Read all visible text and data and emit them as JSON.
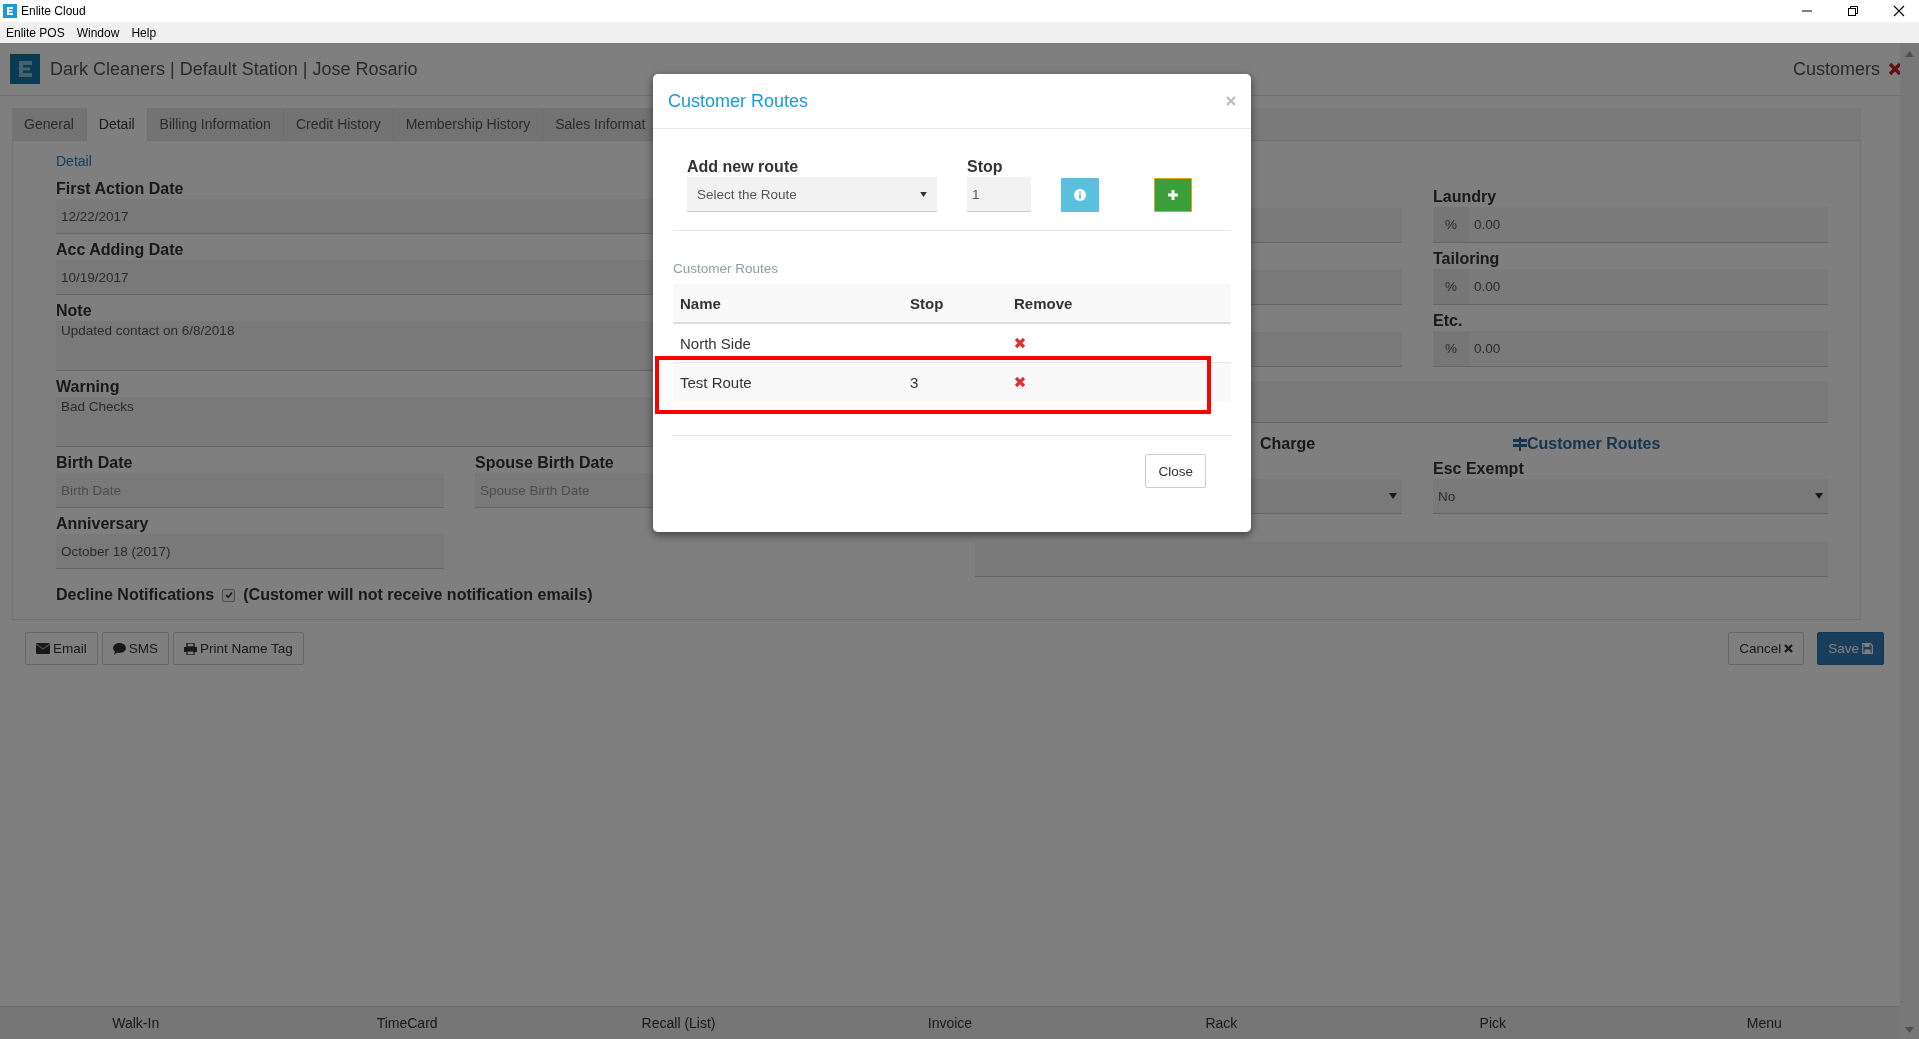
{
  "window": {
    "title": "Enlite Cloud"
  },
  "menu_bar": [
    "Enlite POS",
    "Window",
    "Help"
  ],
  "header": {
    "title": "Dark Cleaners | Default Station | Jose Rosario",
    "page": "Customers"
  },
  "tabs": [
    {
      "label": "General",
      "selected": false
    },
    {
      "label": "Detail",
      "selected": true
    },
    {
      "label": "Billing Information",
      "selected": false
    },
    {
      "label": "Credit History",
      "selected": false
    },
    {
      "label": "Membership History",
      "selected": false
    },
    {
      "label": "Sales Informat",
      "selected": false
    }
  ],
  "detail": {
    "section": "Detail",
    "fields": [
      {
        "label": "First Action Date",
        "value": "12/22/2017",
        "kind": "line"
      },
      {
        "label": "Acc Adding Date",
        "value": "10/19/2017",
        "kind": "line"
      },
      {
        "label": "Note",
        "value": "Updated contact on 6/8/2018",
        "kind": "area"
      },
      {
        "label": "Warning",
        "value": "Bad Checks",
        "kind": "area"
      }
    ],
    "date_row": [
      {
        "label": "Birth Date",
        "placeholder": "Birth Date"
      },
      {
        "label": "Spouse Birth Date",
        "placeholder": "Spouse Birth Date"
      }
    ],
    "anniversary": {
      "label": "Anniversary",
      "value": "October 18 (2017)"
    },
    "decline": {
      "label": "Decline Notifications",
      "checked": true,
      "note": "(Customer will not receive notification emails)"
    }
  },
  "right": {
    "discounts": [
      {
        "label": "Laundry",
        "unit": "%",
        "value": "0.00"
      },
      {
        "label": "Tailoring",
        "unit": "%",
        "value": "0.00"
      },
      {
        "label": "Etc.",
        "unit": "%",
        "value": "0.00"
      }
    ],
    "charge_label": "Charge",
    "routes_link": "Customer Routes",
    "esc_exempt": {
      "label": "Esc Exempt",
      "value": "No"
    }
  },
  "actions": [
    {
      "label": "Email",
      "kind": "email"
    },
    {
      "label": "SMS",
      "kind": "sms"
    },
    {
      "label": "Print Name Tag",
      "kind": "print"
    }
  ],
  "form_buttons": [
    {
      "label": "Cancel",
      "kind": "cancel"
    },
    {
      "label": "Save",
      "kind": "save"
    }
  ],
  "bottom_nav": [
    "Walk-In",
    "TimeCard",
    "Recall (List)",
    "Invoice",
    "Rack",
    "Pick",
    "Menu"
  ],
  "modal": {
    "title": "Customer Routes",
    "add_label": "Add new route",
    "route_placeholder": "Select the Route",
    "stop_label": "Stop",
    "stop_value": "1",
    "list_title": "Customer Routes",
    "columns": [
      "Name",
      "Stop",
      "Remove"
    ],
    "rows": [
      {
        "name": "North Side",
        "stop": "",
        "highlighted": false
      },
      {
        "name": "Test Route",
        "stop": "3",
        "highlighted": true
      }
    ],
    "close": "Close"
  }
}
